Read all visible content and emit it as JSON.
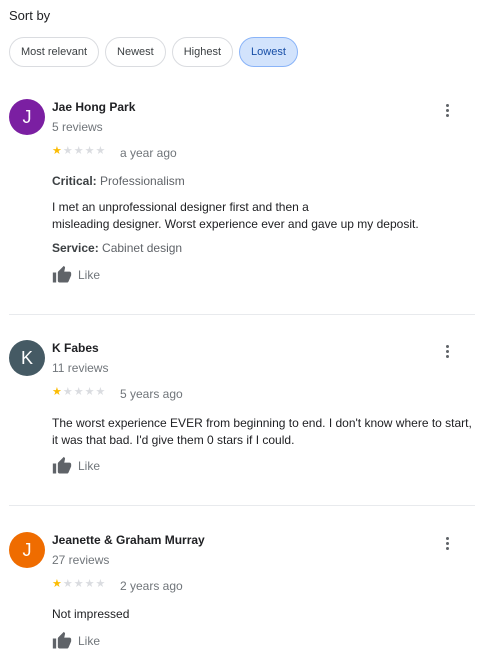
{
  "sort": {
    "label": "Sort by",
    "options": [
      "Most relevant",
      "Newest",
      "Highest",
      "Lowest"
    ],
    "selected": "Lowest"
  },
  "reviews": [
    {
      "initial": "J",
      "avatar_color": "#7b1fa2",
      "name": "Jae Hong Park",
      "count": "5 reviews",
      "rating": 1,
      "time": "a year ago",
      "critical_label": "Critical:",
      "critical_value": "Professionalism",
      "text_line1": "I met an unprofessional designer first and then a",
      "text_line2": "misleading designer. Worst experience ever and gave up my deposit.",
      "service_label": "Service:",
      "service_value": "Cabinet design",
      "like_label": "Like"
    },
    {
      "initial": "K",
      "avatar_color": "#455a64",
      "name": "K Fabes",
      "count": "11 reviews",
      "rating": 1,
      "time": "5 years ago",
      "text": "The worst experience EVER from beginning to end. I don't know where to start, it was that bad. I'd give them 0 stars if I could.",
      "like_label": "Like"
    },
    {
      "initial": "J",
      "avatar_color": "#ef6c00",
      "name": "Jeanette & Graham Murray",
      "count": "27 reviews",
      "rating": 1,
      "time": "2 years ago",
      "text": "Not impressed",
      "like_label": "Like"
    }
  ],
  "icons": {
    "menu": "more-vert-icon",
    "like": "thumb-up-icon",
    "star": "star-icon"
  }
}
